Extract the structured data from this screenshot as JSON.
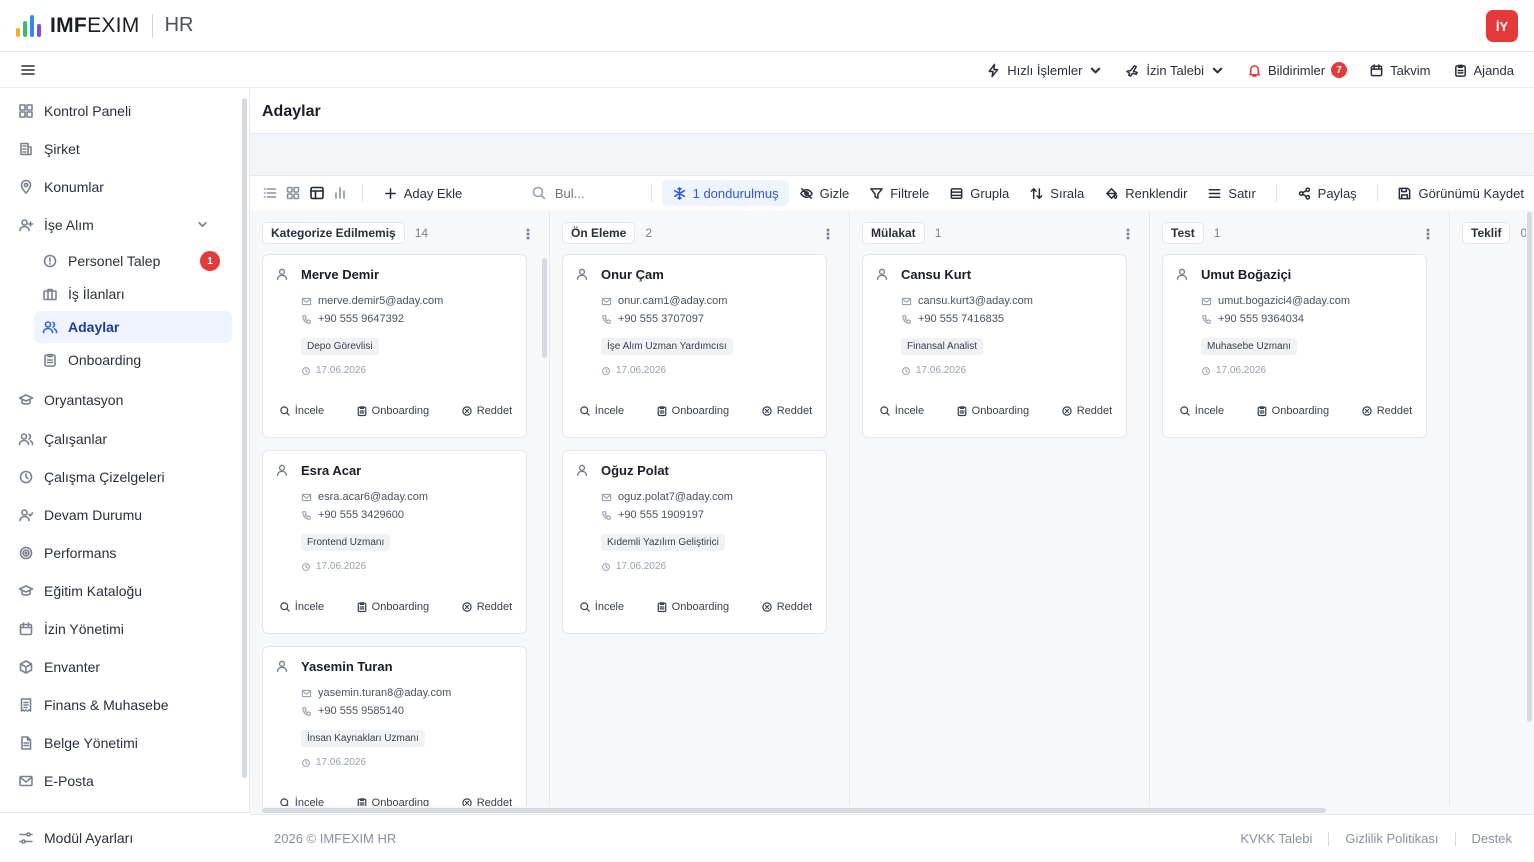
{
  "app": {
    "brand_bold": "IMF",
    "brand_light": "EXIM",
    "product": "HR",
    "avatar_initials": "İY",
    "logo_colors": [
      "#f2b21f",
      "#3dbb6b",
      "#2d8cf0",
      "#7b4fe0"
    ],
    "accent": "#2d5bd6",
    "danger": "#e63a3a"
  },
  "topbar": {
    "quick_actions": "Hızlı İşlemler",
    "leave_request": "İzin Talebi",
    "notifications": "Bildirimler",
    "notifications_count": "7",
    "calendar": "Takvim",
    "agenda": "Ajanda"
  },
  "sidebar": {
    "items": [
      {
        "label": "Kontrol Paneli",
        "icon": "dashboard-icon"
      },
      {
        "label": "Şirket",
        "icon": "building-icon"
      },
      {
        "label": "Konumlar",
        "icon": "location-pin-icon"
      },
      {
        "label": "İşe Alım",
        "icon": "user-plus-icon",
        "expanded": true
      },
      {
        "label": "Personel Talep",
        "icon": "info-circle-icon",
        "badge": "1"
      },
      {
        "label": "İş İlanları",
        "icon": "briefcase-icon"
      },
      {
        "label": "Adaylar",
        "icon": "users-icon",
        "active": true
      },
      {
        "label": "Onboarding",
        "icon": "clipboard-icon"
      },
      {
        "label": "Oryantasyon",
        "icon": "graduation-cap-icon"
      },
      {
        "label": "Çalışanlar",
        "icon": "users-icon"
      },
      {
        "label": "Çalışma Çizelgeleri",
        "icon": "clock-icon"
      },
      {
        "label": "Devam Durumu",
        "icon": "user-check-icon"
      },
      {
        "label": "Performans",
        "icon": "target-icon"
      },
      {
        "label": "Eğitim Kataloğu",
        "icon": "graduation-cap-icon"
      },
      {
        "label": "İzin Yönetimi",
        "icon": "calendar-icon"
      },
      {
        "label": "Envanter",
        "icon": "box-icon"
      },
      {
        "label": "Finans & Muhasebe",
        "icon": "receipt-icon"
      },
      {
        "label": "Belge Yönetimi",
        "icon": "document-icon"
      },
      {
        "label": "E-Posta",
        "icon": "mail-icon"
      }
    ],
    "module_settings": "Modül Ayarları"
  },
  "page": {
    "title": "Adaylar"
  },
  "toolbar": {
    "add_candidate": "Aday Ekle",
    "search_placeholder": "Bul...",
    "frozen": "1 dondurulmuş",
    "hide": "Gizle",
    "filter": "Filtrele",
    "group": "Grupla",
    "sort": "Sırala",
    "color": "Renklendir",
    "row": "Satır",
    "share": "Paylaş",
    "save_view": "Görünümü Kaydet"
  },
  "card_actions": {
    "review": "İncele",
    "onboarding": "Onboarding",
    "reject": "Reddet"
  },
  "columns": [
    {
      "name": "Kategorize Edilmemiş",
      "count": "14",
      "cards": [
        {
          "name": "Merve Demir",
          "email": "merve.demir5@aday.com",
          "phone": "+90 555 9647392",
          "position": "Depo Görevlisi",
          "date": "17.06.2026"
        },
        {
          "name": "Esra Acar",
          "email": "esra.acar6@aday.com",
          "phone": "+90 555 3429600",
          "position": "Frontend Uzmanı",
          "date": "17.06.2026"
        },
        {
          "name": "Yasemin Turan",
          "email": "yasemin.turan8@aday.com",
          "phone": "+90 555 9585140",
          "position": "İnsan Kaynakları Uzmanı",
          "date": "17.06.2026"
        }
      ]
    },
    {
      "name": "Ön Eleme",
      "count": "2",
      "cards": [
        {
          "name": "Onur Çam",
          "email": "onur.cam1@aday.com",
          "phone": "+90 555 3707097",
          "position": "İşe Alım Uzman Yardımcısı",
          "date": "17.06.2026"
        },
        {
          "name": "Oğuz Polat",
          "email": "oguz.polat7@aday.com",
          "phone": "+90 555 1909197",
          "position": "Kıdemli Yazılım Geliştirici",
          "date": "17.06.2026"
        }
      ]
    },
    {
      "name": "Mülakat",
      "count": "1",
      "cards": [
        {
          "name": "Cansu Kurt",
          "email": "cansu.kurt3@aday.com",
          "phone": "+90 555 7416835",
          "position": "Finansal Analist",
          "date": "17.06.2026"
        }
      ]
    },
    {
      "name": "Test",
      "count": "1",
      "cards": [
        {
          "name": "Umut Boğaziçi",
          "email": "umut.bogazici4@aday.com",
          "phone": "+90 555 9364034",
          "position": "Muhasebe Uzmanı",
          "date": "17.06.2026"
        }
      ]
    },
    {
      "name": "Teklif",
      "count": "0",
      "cards": []
    }
  ],
  "footer": {
    "copyright": "2026 © IMFEXIM HR",
    "kvkk": "KVKK Talebi",
    "privacy": "Gizlilik Politikası",
    "support": "Destek"
  }
}
